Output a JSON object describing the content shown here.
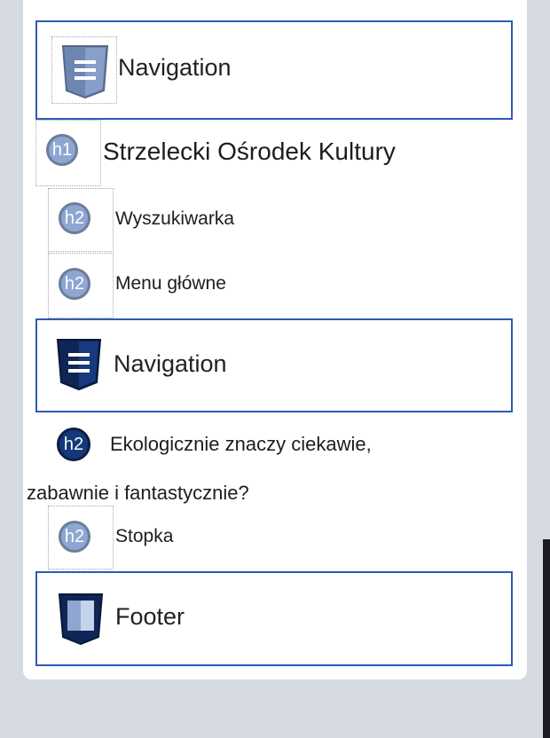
{
  "landmarks": [
    {
      "type": "navigation",
      "label": "Navigation",
      "icon": "navigation-list-icon",
      "style": "light"
    },
    {
      "type": "navigation",
      "label": "Navigation",
      "icon": "navigation-list-icon",
      "style": "dark"
    },
    {
      "type": "footer",
      "label": "Footer",
      "icon": "footer-icon"
    }
  ],
  "headings": [
    {
      "level_label": "h1",
      "text": "Strzelecki Ośrodek Kultury",
      "style": "light"
    },
    {
      "level_label": "h2",
      "text": "Wyszukiwarka",
      "style": "light"
    },
    {
      "level_label": "h2",
      "text": "Menu główne",
      "style": "light"
    },
    {
      "level_label": "h2",
      "text_line1": "Ekologicznie znaczy ciekawie,",
      "text_line2": "zabawnie i fantastycznie?",
      "style": "dark"
    },
    {
      "level_label": "h2",
      "text": "Stopka",
      "style": "light"
    }
  ],
  "colors": {
    "region_border": "#2c5bb8",
    "badge_light": "#8ea6d2",
    "badge_dark": "#15387a",
    "background": "#d6dbe3"
  }
}
